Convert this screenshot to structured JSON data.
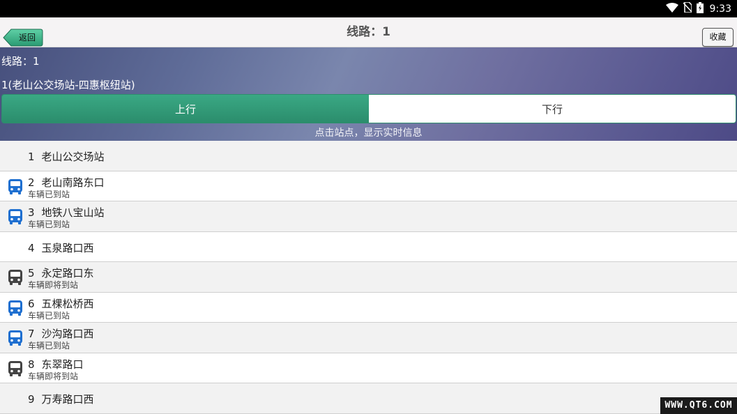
{
  "status_bar": {
    "time": "9:33",
    "icons": [
      "wifi-icon",
      "no-sim-icon",
      "battery-icon"
    ]
  },
  "app_bar": {
    "back_label": "返回",
    "title": "线路：1",
    "favorite_label": "收藏"
  },
  "route": {
    "line_label": "线路：1",
    "full_name": "1(老山公交场站-四惠枢纽站)",
    "direction_tabs": [
      {
        "label": "上行",
        "active": true
      },
      {
        "label": "下行",
        "active": false
      }
    ],
    "hint": "点击站点，显示实时信息"
  },
  "stations": [
    {
      "num": "1",
      "name": "老山公交场站",
      "status": "",
      "bus": "none"
    },
    {
      "num": "2",
      "name": "老山南路东口",
      "status": "车辆已到站",
      "bus": "arrived"
    },
    {
      "num": "3",
      "name": "地铁八宝山站",
      "status": "车辆已到站",
      "bus": "arrived"
    },
    {
      "num": "4",
      "name": "玉泉路口西",
      "status": "",
      "bus": "none"
    },
    {
      "num": "5",
      "name": "永定路口东",
      "status": "车辆即将到站",
      "bus": "approaching"
    },
    {
      "num": "6",
      "name": "五棵松桥西",
      "status": "车辆已到站",
      "bus": "arrived"
    },
    {
      "num": "7",
      "name": "沙沟路口西",
      "status": "车辆已到站",
      "bus": "arrived"
    },
    {
      "num": "8",
      "name": "东翠路口",
      "status": "车辆即将到站",
      "bus": "approaching"
    },
    {
      "num": "9",
      "name": "万寿路口西",
      "status": "",
      "bus": "none"
    }
  ],
  "colors": {
    "accent_green": "#2e9d77",
    "bus_arrived": "#1e6fd0",
    "bus_approaching": "#444444"
  },
  "watermark": "WWW.QT6.COM"
}
